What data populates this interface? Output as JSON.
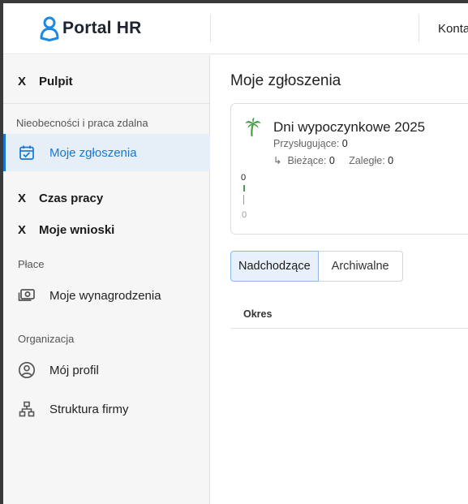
{
  "header": {
    "app_name": "Portal HR",
    "contact_label": "Konta"
  },
  "sidebar": {
    "dashboard": {
      "marker": "X",
      "label": "Pulpit"
    },
    "section_absence": "Nieobecności i praca zdalna",
    "my_requests": "Moje zgłoszenia",
    "work_time": {
      "marker": "X",
      "label": "Czas pracy"
    },
    "my_applications": {
      "marker": "X",
      "label": "Moje wnioski"
    },
    "section_pay": "Płace",
    "my_salary": "Moje wynagrodzenia",
    "section_org": "Organizacja",
    "my_profile": "Mój profil",
    "company_structure": "Struktura firmy"
  },
  "main": {
    "title": "Moje zgłoszenia",
    "card": {
      "title": "Dni wypoczynkowe 2025",
      "entitled_label": "Przysługujące:",
      "entitled_value": "0",
      "arrow": "↳",
      "current_label": "Bieżące:",
      "current_value": "0",
      "overdue_label": "Zaległe:",
      "overdue_value": "0",
      "chart_top": "0",
      "chart_bottom": "0"
    },
    "tabs": {
      "upcoming": "Nadchodzące",
      "archived": "Archiwalne"
    },
    "table": {
      "col_period": "Okres"
    }
  },
  "colors": {
    "accent": "#1678d4",
    "logo": "#1e88e5",
    "palm": "#43a047"
  }
}
